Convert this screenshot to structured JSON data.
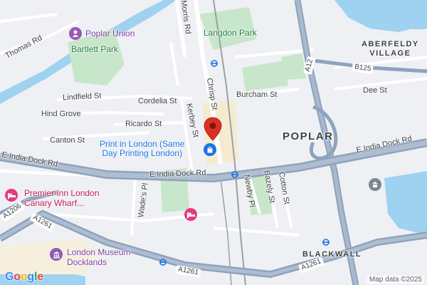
{
  "areas": {
    "poplar": "POPLAR",
    "blackwall": "BLACKWALL",
    "aberfeldy": "ABERFELDY\nVILLAGE"
  },
  "parks": {
    "langdon_park": "Langdon Park",
    "bartlett_park": "Bartlett Park"
  },
  "streets": {
    "morris_rd": "Morris Rd",
    "chrisp_st": "Chrisp St",
    "thomas_rd": "Thomas Rd",
    "lindfield_st": "Lindfield St",
    "hind_grove": "Hind Grove",
    "cordelia_st": "Cordelia St",
    "kerbey_st": "Kerbey St",
    "ricardo_st": "Ricardo St",
    "canton_st": "Canton St",
    "burcham_st": "Burcham St",
    "dee_st": "Dee St",
    "e_india_dock_rd_west": "E India Dock Rd",
    "e_india_dock_rd_center": "E India Dock Rd",
    "e_india_dock_rd_east": "E India Dock Rd",
    "wades_pl": "Wade's Pl",
    "newby_pl": "Newby Pl",
    "bazely_st": "Bazely St",
    "cotton_st": "Cotton St"
  },
  "shields": {
    "a12": "A12",
    "b125": "B125",
    "a1206": "A1206",
    "a1261_west": "A1261",
    "a1261_center": "A1261",
    "a1261_east": "A1261"
  },
  "pois": {
    "poplar_union": "Poplar Union",
    "selected_place": "Print in London (Same\nDay Printing London)",
    "premier_inn": "Premier Inn London\nCanary Wharf...",
    "london_museum": "London Museum\nDocklands"
  },
  "icon_colors": {
    "selected_pin": "#d93025",
    "poi_purple": "#9b59b6",
    "hotel_pink": "#e5397e",
    "shopping_blue": "#1a73e8",
    "museum_purple": "#8e5bb5"
  },
  "logo": {
    "text": "Google",
    "colors": [
      "#4285F4",
      "#EA4335",
      "#FBBC05",
      "#4285F4",
      "#34A853",
      "#EA4335"
    ]
  },
  "attribution": "Map data ©2025"
}
